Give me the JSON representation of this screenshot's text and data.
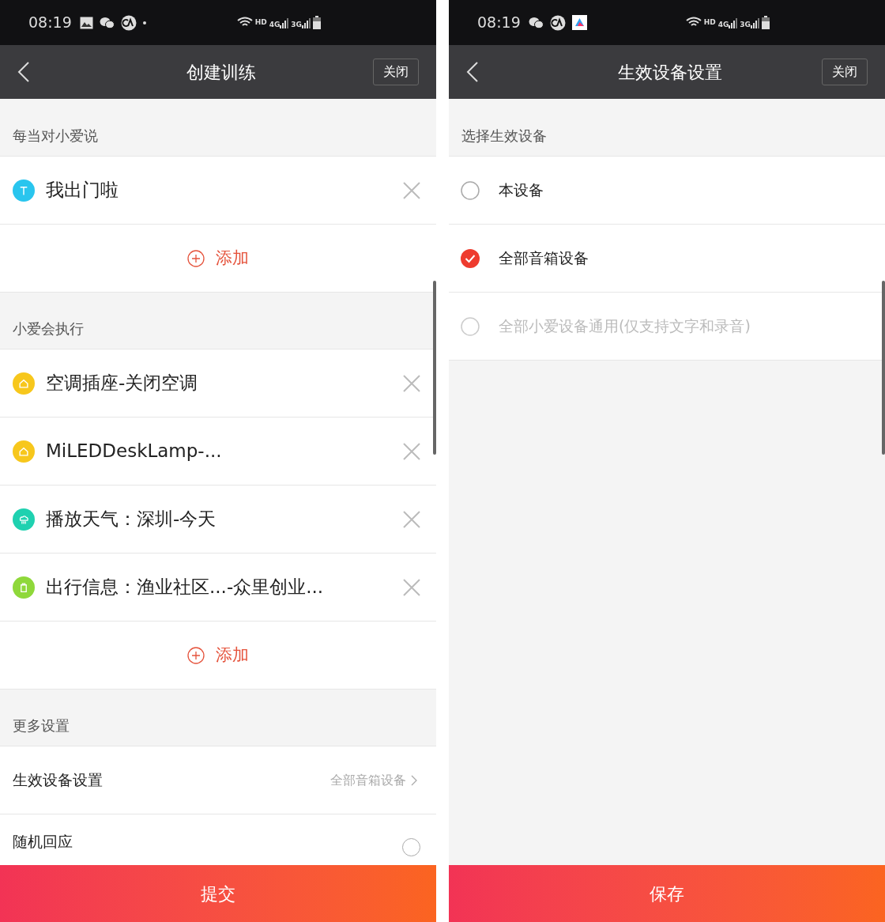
{
  "left_screen": {
    "status_bar": {
      "time": "08:19",
      "notification_icons": [
        {
          "kind": "image"
        },
        {
          "kind": "chat"
        },
        {
          "kind": "ca"
        },
        {
          "kind": "dot"
        }
      ],
      "network_labels": [
        "HD",
        "4G",
        "3G"
      ]
    },
    "header": {
      "title": "创建训练",
      "close_button": "关闭"
    },
    "sections": [
      {
        "title": "每当对小爱说",
        "rows": [
          {
            "kind": "item",
            "color": "#29c5ee",
            "text": "我出门啦"
          }
        ],
        "add_button": "添加"
      },
      {
        "title": "小爱会执行",
        "rows": [
          {
            "kind": "item",
            "color": "#f7c71c",
            "text": "空调插座-关闭空调"
          },
          {
            "kind": "item",
            "color": "#f7c71c",
            "text": "MiLEDDeskLamp-..."
          },
          {
            "kind": "item",
            "color": "#1fd1b0",
            "text": "播放天气：深圳-今天"
          },
          {
            "kind": "item",
            "color": "#8fd83a",
            "text": "出行信息：渔业社区...-众里创业..."
          }
        ],
        "add_button": "添加"
      },
      {
        "title": "更多设置",
        "rows": [
          {
            "kind": "link",
            "text": "生效设备设置",
            "value": "全部音箱设备"
          },
          {
            "kind": "toggle",
            "text": "随机回应",
            "checked": false
          }
        ]
      }
    ],
    "submit_button": "提交"
  },
  "right_screen": {
    "status_bar": {
      "time": "08:19",
      "notification_icons": [
        {
          "kind": "chat"
        },
        {
          "kind": "ca"
        },
        {
          "kind": "app"
        }
      ],
      "network_labels": [
        "HD",
        "4G",
        "3G"
      ]
    },
    "header": {
      "title": "生效设备设置",
      "close_button": "关闭"
    },
    "section_title": "选择生效设备",
    "options": [
      {
        "label": "本设备",
        "selected": false,
        "disabled": false
      },
      {
        "label": "全部音箱设备",
        "selected": true,
        "disabled": false
      },
      {
        "label": "全部小爱设备通用(仅支持文字和录音)",
        "selected": false,
        "disabled": true
      }
    ],
    "save_button": "保存"
  }
}
